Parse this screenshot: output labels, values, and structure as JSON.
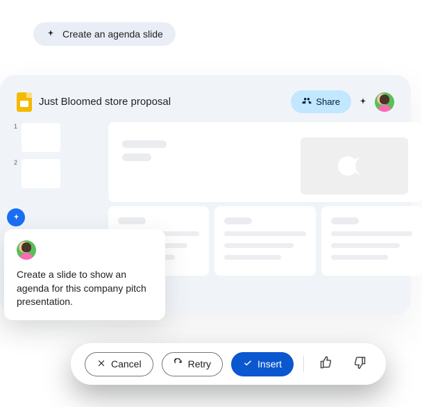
{
  "chip": {
    "label": "Create an agenda slide"
  },
  "header": {
    "title": "Just Bloomed store proposal",
    "share_label": "Share"
  },
  "thumbnails": {
    "numbers": [
      "1",
      "2"
    ]
  },
  "prompt": {
    "text": "Create a slide to show an agenda for this company pitch presentation."
  },
  "actions": {
    "cancel": "Cancel",
    "retry": "Retry",
    "insert": "Insert"
  }
}
